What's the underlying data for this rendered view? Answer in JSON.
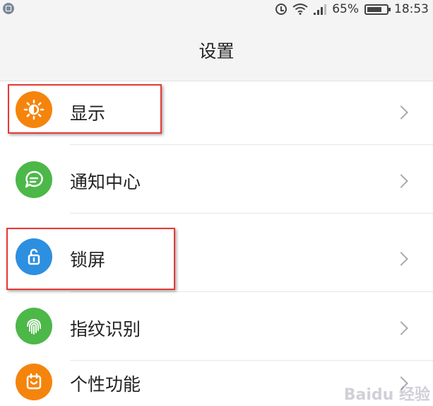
{
  "status_bar": {
    "battery": "65%",
    "time": "18:53"
  },
  "header": {
    "title": "设置"
  },
  "settings_items": [
    {
      "label": "显示",
      "icon": "sun-icon",
      "color": "#f5840c"
    },
    {
      "label": "通知中心",
      "icon": "chat-bubble-icon",
      "color": "#4cb848"
    },
    {
      "label": "锁屏",
      "icon": "unlock-icon",
      "color": "#2d8fe0"
    },
    {
      "label": "指纹识别",
      "icon": "fingerprint-icon",
      "color": "#4cb848"
    },
    {
      "label": "个性功能",
      "icon": "calendar-icon",
      "color": "#f5840c"
    }
  ],
  "highlights": [
    "显示",
    "锁屏"
  ],
  "watermark": "Baidu 经验"
}
